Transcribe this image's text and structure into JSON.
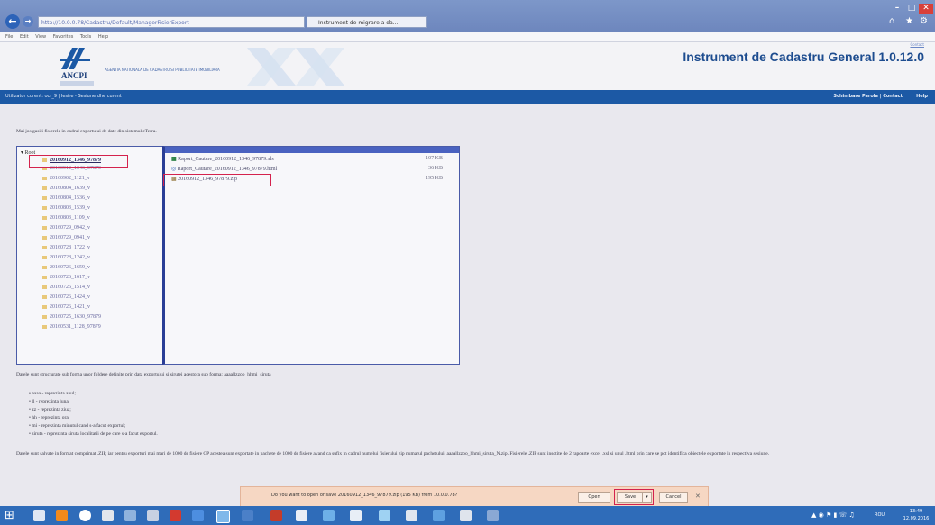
{
  "browser": {
    "address": "http://10.0.0.78/Cadastru/Default/ManagerFisierExport",
    "tab_title": "Instrument de migrare a da...",
    "menu": [
      "File",
      "Edit",
      "View",
      "Favorites",
      "Tools",
      "Help"
    ]
  },
  "header": {
    "logo_text": "ANCPI",
    "agency_text": "AGENTIA NATIONALA DE CADASTRU SI PUBLICITATE IMOBILIARA",
    "app_title": "Instrument de Cadastru General 1.0.12.0",
    "top_right_link": "Contact"
  },
  "bluebar": {
    "left_text": "Utilizator curent: ocr_9 | Iesire - Sesiune dhe curent",
    "right_text": "Schimbare Parola | Contact",
    "help": "Help"
  },
  "intro": "Mai jos gasiti fisierele in cadrul exportului de date din sistemul eTerra.",
  "tree": {
    "root": "Root",
    "items": [
      "20160912_1346_97879",
      "20160912_1346_97879",
      "20160902_1121_v",
      "20160804_1639_v",
      "20160804_1536_v",
      "20160803_1539_v",
      "20160803_1109_v",
      "20160729_0942_v",
      "20160729_0941_v",
      "20160728_1722_v",
      "20160728_1242_v",
      "20160726_1659_v",
      "20160726_1617_v",
      "20160726_1514_v",
      "20160726_1424_v",
      "20160726_1421_v",
      "20160725_1630_97879",
      "20160531_1128_97879"
    ]
  },
  "files": [
    {
      "name": "Raport_Cautare_20160912_1346_97879.xls",
      "size": "107 KB"
    },
    {
      "name": "Raport_Cautare_20160912_1346_97879.html",
      "size": "36 KB"
    },
    {
      "name": "20160912_1346_97879.zip",
      "size": "195 KB"
    }
  ],
  "description": "Datele sunt structurate sub forma unor foldere definite prin data exportului si sirutei acestora sub forma: aaaallzzoo_hhmi_siruta",
  "bullets": [
    "aaaa - reprezinta anul;",
    "ll - reprezinta luna;",
    "zz - reprezinta ziua;",
    "hh - reprezinta ora;",
    "mi - reprezinta minutul cand s-a facut exportul;",
    "siruta - reprezinta siruta localitatii de pe care s-a facut exportul."
  ],
  "zip_note": "Datele sunt salvate in format comprimat .ZIP, iar pentru exporturi mai mari de 1000 de fisiere CP acestea sunt exportate in pachete de 1000 de fisiere avand ca sufix in cadrul numelui fisierului zip numarul pachetului: aaaallzzoo_hhmi_siruta_N.zip. Fisierele .ZIP sunt insotite de 2 rapoarte excel .xsl si unul .html prin care se pot identifica obiectele exportate in respectiva sesiune.",
  "download_bar": {
    "message": "Do you want to open or save 20160912_1346_97879.zip (195 KB) from 10.0.0.78?",
    "open": "Open",
    "save": "Save",
    "cancel": "Cancel"
  },
  "taskbar": {
    "lang": "ROU",
    "time": "13:49",
    "date": "12.09.2016"
  },
  "colors": {
    "accent_blue": "#1c59a5",
    "highlight_red": "#d4224d"
  }
}
